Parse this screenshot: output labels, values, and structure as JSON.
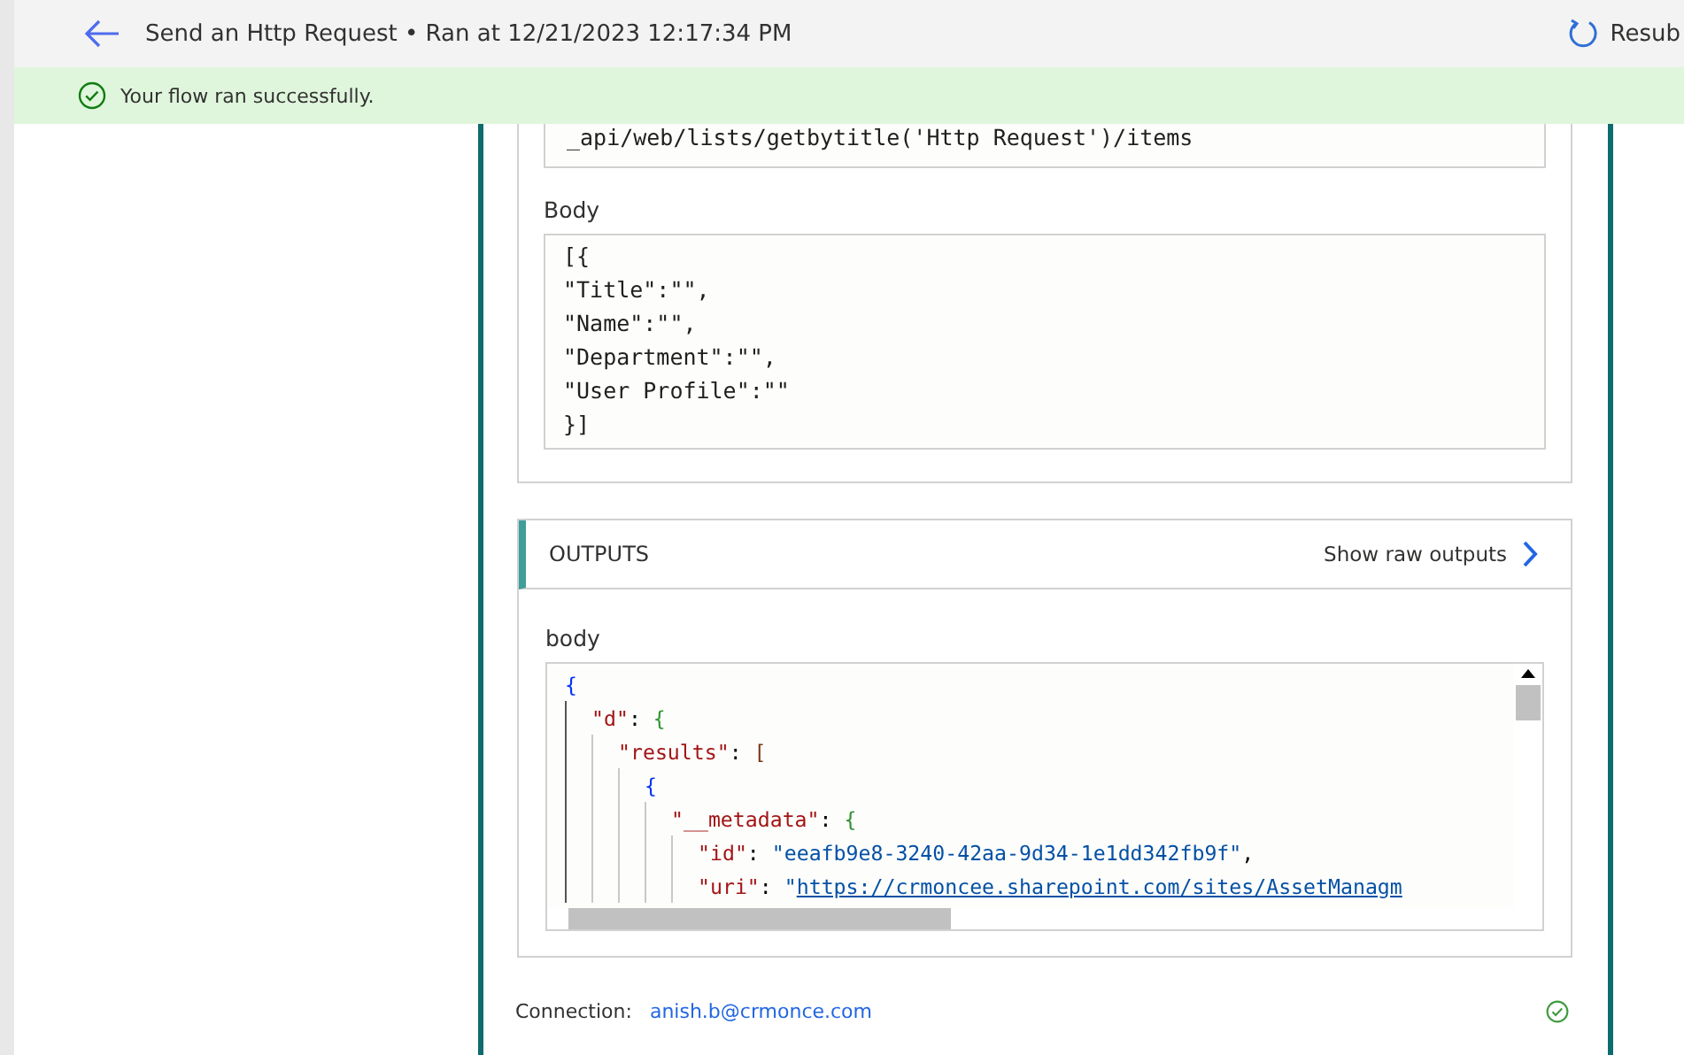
{
  "header": {
    "title": "Send an Http Request • Ran at 12/21/2023 12:17:34 PM",
    "resubmit": "Resub"
  },
  "banner": {
    "message": "Your flow ran successfully."
  },
  "inputs": {
    "uri_value": "_api/web/lists/getbytitle('Http Request')/items",
    "body_label": "Body",
    "body_lines": [
      "[{",
      "\"Title\":\"\",",
      "\"Name\":\"\",",
      "\"Department\":\"\",",
      "\"User Profile\":\"\"",
      "}]"
    ]
  },
  "outputs": {
    "title": "OUTPUTS",
    "raw_link": "Show raw outputs",
    "body_label": "body",
    "code": [
      {
        "tokens": [
          {
            "kind": "bracket",
            "text": "{"
          }
        ],
        "children": [
          {
            "tokens": [
              {
                "kind": "key",
                "text": "\"d\""
              },
              {
                "kind": "punct",
                "text": ": "
              },
              {
                "kind": "bracket",
                "text": "{"
              }
            ],
            "children": [
              {
                "tokens": [
                  {
                    "kind": "key",
                    "text": "\"results\""
                  },
                  {
                    "kind": "punct",
                    "text": ": "
                  },
                  {
                    "kind": "bracket",
                    "text": "["
                  }
                ],
                "children": [
                  {
                    "tokens": [
                      {
                        "kind": "bracket",
                        "text": "{"
                      }
                    ],
                    "children": [
                      {
                        "tokens": [
                          {
                            "kind": "key",
                            "text": "\"__metadata\""
                          },
                          {
                            "kind": "punct",
                            "text": ": "
                          },
                          {
                            "kind": "bracket",
                            "text": "{"
                          }
                        ],
                        "children": [
                          {
                            "tokens": [
                              {
                                "kind": "key",
                                "text": "\"id\""
                              },
                              {
                                "kind": "punct",
                                "text": ": "
                              },
                              {
                                "kind": "string",
                                "text": "\"eeafb9e8-3240-42aa-9d34-1e1dd342fb9f\""
                              },
                              {
                                "kind": "punct",
                                "text": ","
                              }
                            ]
                          },
                          {
                            "tokens": [
                              {
                                "kind": "key",
                                "text": "\"uri\""
                              },
                              {
                                "kind": "punct",
                                "text": ": "
                              },
                              {
                                "kind": "string",
                                "text": "\""
                              },
                              {
                                "kind": "link",
                                "text": "https://crmoncee.sharepoint.com/sites/AssetManagm"
                              }
                            ]
                          }
                        ]
                      }
                    ]
                  }
                ]
              }
            ]
          }
        ]
      }
    ]
  },
  "connection": {
    "label": "Connection:",
    "value": "anish.b@crmonce.com"
  }
}
